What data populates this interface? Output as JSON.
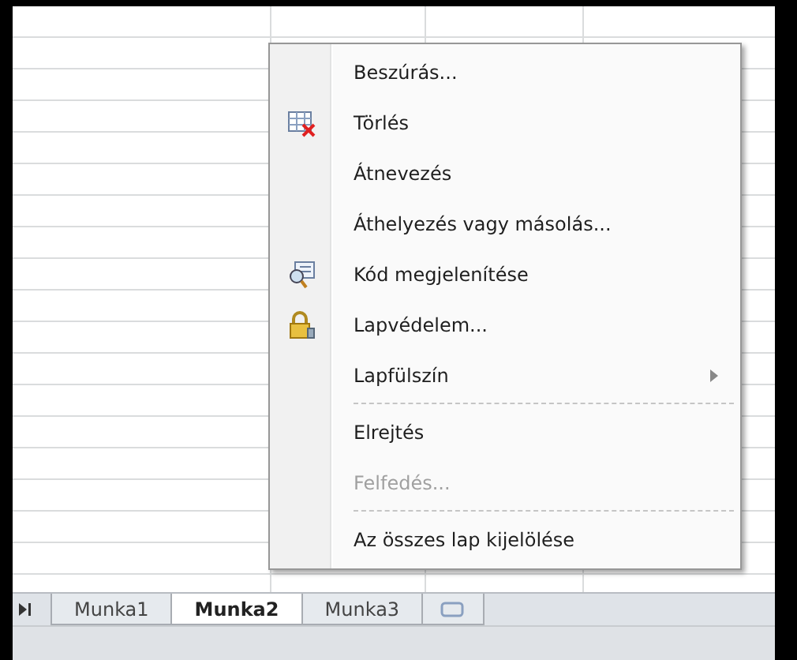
{
  "sheet_tabs": [
    {
      "label": "Munka1",
      "selected": false
    },
    {
      "label": "Munka2",
      "selected": true
    },
    {
      "label": "Munka3",
      "selected": false
    }
  ],
  "context_menu": {
    "items": [
      {
        "label": "Beszúrás...",
        "kind": "plain",
        "disabled": false,
        "submenu": false,
        "separator_before": false
      },
      {
        "label": "Törlés",
        "kind": "delete",
        "disabled": false,
        "submenu": false,
        "separator_before": false
      },
      {
        "label": "Átnevezés",
        "kind": "plain",
        "disabled": false,
        "submenu": false,
        "separator_before": false
      },
      {
        "label": "Áthelyezés vagy másolás...",
        "kind": "plain",
        "disabled": false,
        "submenu": false,
        "separator_before": false
      },
      {
        "label": "Kód megjelenítése",
        "kind": "code",
        "disabled": false,
        "submenu": false,
        "separator_before": false
      },
      {
        "label": "Lapvédelem...",
        "kind": "protect",
        "disabled": false,
        "submenu": false,
        "separator_before": false
      },
      {
        "label": "Lapfülszín",
        "kind": "plain",
        "disabled": false,
        "submenu": true,
        "separator_before": false
      },
      {
        "label": "Elrejtés",
        "kind": "plain",
        "disabled": false,
        "submenu": false,
        "separator_before": true
      },
      {
        "label": "Felfedés...",
        "kind": "plain",
        "disabled": true,
        "submenu": false,
        "separator_before": false
      },
      {
        "label": "Az összes lap kijelölése",
        "kind": "plain",
        "disabled": false,
        "submenu": false,
        "separator_before": true
      }
    ]
  }
}
